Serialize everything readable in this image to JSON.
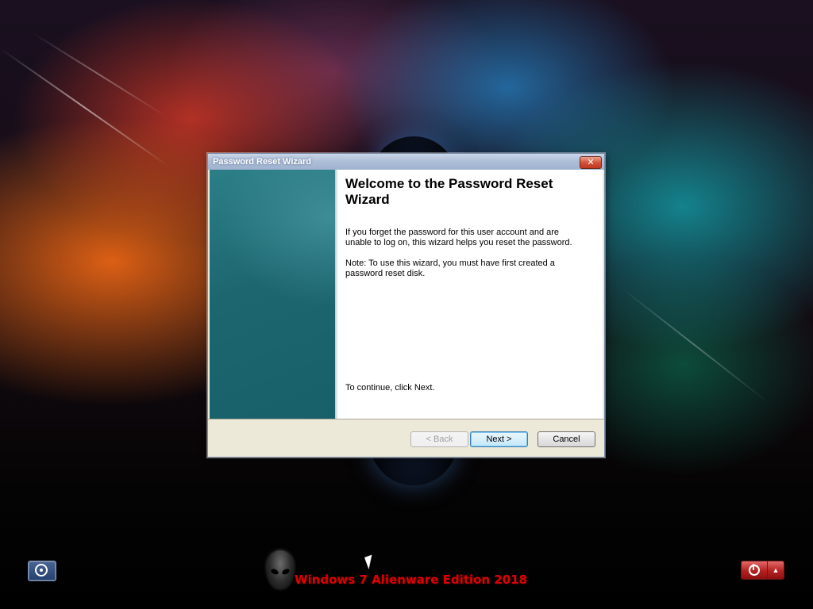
{
  "dialog": {
    "title": "Password Reset Wizard",
    "close_glyph": "✕",
    "heading": "Welcome to the Password Reset Wizard",
    "paragraph1": "If you forget the password for this user account and are unable to log on, this wizard helps you reset the password.",
    "paragraph2": "Note: To use this wizard, you must have first created a password reset disk.",
    "continue_text": "To continue, click Next.",
    "buttons": {
      "back": "< Back",
      "next": "Next >",
      "cancel": "Cancel"
    }
  },
  "bottom_bar": {
    "branding": "Windows 7 Alienware Edition 2018",
    "ease_of_access_icon": "ease-of-access-icon",
    "power_icon": "power-icon",
    "options_glyph": "▲"
  },
  "colors": {
    "branding_text": "#e00000",
    "side_panel": "#1d6670",
    "power_button": "#b52020"
  }
}
